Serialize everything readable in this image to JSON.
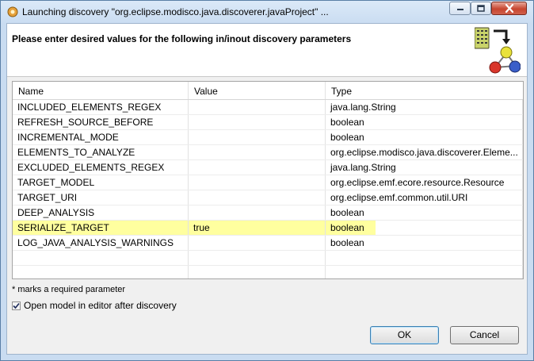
{
  "window": {
    "title": "Launching discovery \"org.eclipse.modisco.java.discoverer.javaProject\" ...",
    "icon": "eclipse-discovery-icon"
  },
  "banner": {
    "message": "Please enter desired values for the following in/inout discovery parameters",
    "icon": "discovery-wizard-icon"
  },
  "table": {
    "headers": {
      "name": "Name",
      "value": "Value",
      "type": "Type"
    },
    "rows": [
      {
        "name": "INCLUDED_ELEMENTS_REGEX",
        "value": "",
        "type": "java.lang.String"
      },
      {
        "name": "REFRESH_SOURCE_BEFORE",
        "value": "",
        "type": "boolean"
      },
      {
        "name": "INCREMENTAL_MODE",
        "value": "",
        "type": "boolean"
      },
      {
        "name": "ELEMENTS_TO_ANALYZE",
        "value": "",
        "type": "org.eclipse.modisco.java.discoverer.Eleme..."
      },
      {
        "name": "EXCLUDED_ELEMENTS_REGEX",
        "value": "",
        "type": "java.lang.String"
      },
      {
        "name": "TARGET_MODEL",
        "value": "",
        "type": "org.eclipse.emf.ecore.resource.Resource"
      },
      {
        "name": "TARGET_URI",
        "value": "",
        "type": "org.eclipse.emf.common.util.URI"
      },
      {
        "name": "DEEP_ANALYSIS",
        "value": "",
        "type": "boolean"
      },
      {
        "name": "SERIALIZE_TARGET",
        "value": "true",
        "type": "boolean",
        "highlighted": true
      },
      {
        "name": "LOG_JAVA_ANALYSIS_WARNINGS",
        "value": "",
        "type": "boolean"
      }
    ],
    "highlight_color": "#ffff9f"
  },
  "hint": "* marks a required parameter",
  "open_in_editor": {
    "label": "Open model in editor after discovery",
    "checked": true
  },
  "buttons": {
    "ok": "OK",
    "cancel": "Cancel"
  }
}
